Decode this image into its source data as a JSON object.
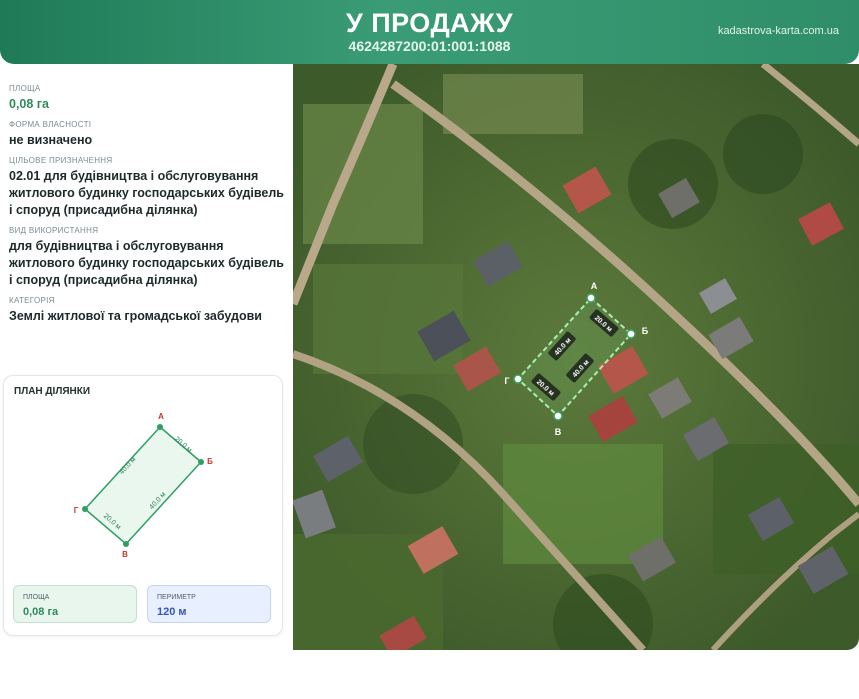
{
  "header": {
    "title": "У ПРОДАЖУ",
    "cadastral_number": "4624287200:01:001:1088",
    "site": "kadastrova-karta.com.ua"
  },
  "info": {
    "area_label": "ПЛОЩА",
    "area_value": "0,08 га",
    "ownership_label": "ФОРМА ВЛАСНОСТІ",
    "ownership_value": "не визначено",
    "purpose_label": "ЦІЛЬОВЕ ПРИЗНАЧЕННЯ",
    "purpose_value": "02.01 для будівництва і обслуговування житлового будинку господарських будівель і споруд (присадибна ділянка)",
    "usage_label": "ВИД ВИКОРИСТАННЯ",
    "usage_value": "для будівництва і обслуговування житлового будинку господарських будівель і споруд (присадибна ділянка)",
    "category_label": "КАТЕГОРІЯ",
    "category_value": "Землі житлової та громадської забудови"
  },
  "plan": {
    "title": "ПЛАН ДІЛЯНКИ",
    "vertices": {
      "a": "А",
      "b": "Б",
      "v": "В",
      "g": "Г"
    },
    "sides": {
      "ab": "20,0 м",
      "bv": "40,0 м",
      "vg": "20,0 м",
      "ga": "40,0 м"
    },
    "area_label": "ПЛОЩА",
    "area_value": "0,08 га",
    "perimeter_label": "ПЕРИМЕТР",
    "perimeter_value": "120 м"
  },
  "map": {
    "vertices": {
      "a": "А",
      "b": "Б",
      "v": "В",
      "g": "Г"
    },
    "sides": {
      "ab": "20.0 м",
      "bv": "40.0 м",
      "vg": "20.0 м",
      "ga": "40.0 м"
    }
  },
  "colors": {
    "header_green": "#2f8e69",
    "parcel_outline": "#7de08d",
    "vertex_label": "#c0392b",
    "plan_line": "#2e9f63"
  }
}
